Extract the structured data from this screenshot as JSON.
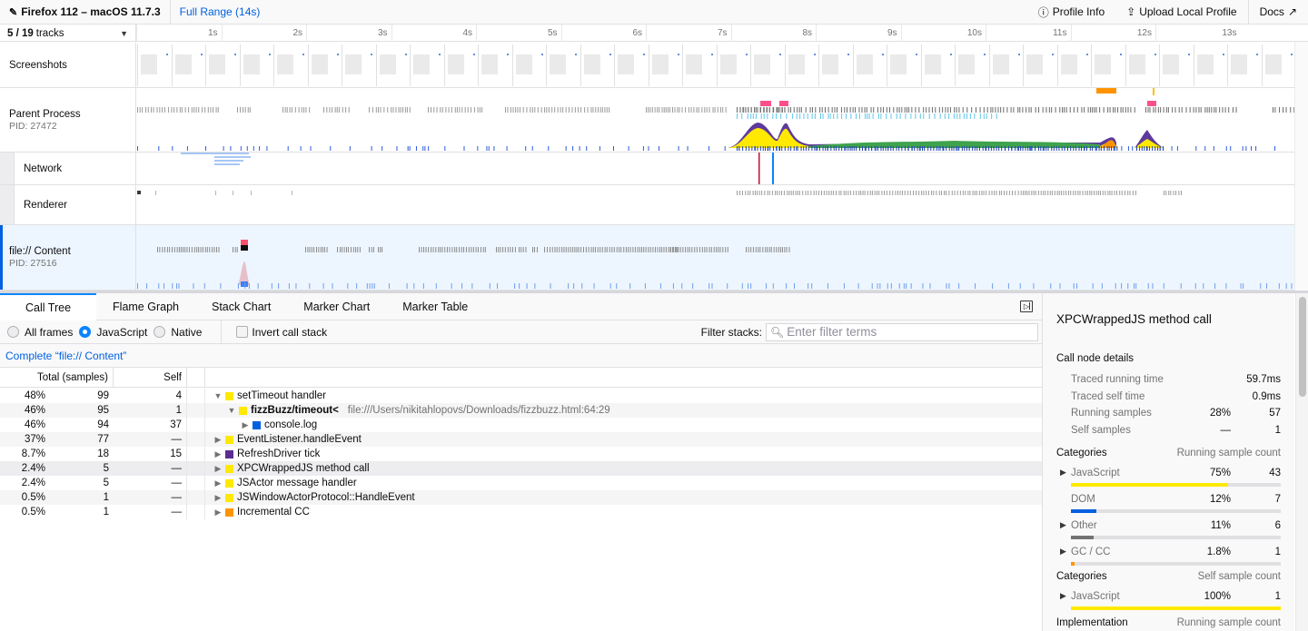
{
  "topbar": {
    "title": "Firefox 112 – macOS 11.7.3",
    "range": "Full Range (14s)",
    "profile_info": "Profile Info",
    "upload": "Upload Local Profile",
    "docs": "Docs"
  },
  "timeline": {
    "tracks_visible": "5 / 19",
    "tracks_label": "tracks",
    "ticks": [
      "1s",
      "2s",
      "3s",
      "4s",
      "5s",
      "6s",
      "7s",
      "8s",
      "9s",
      "10s",
      "11s",
      "12s",
      "13s"
    ],
    "tracks": [
      {
        "name": "Screenshots"
      },
      {
        "name": "Parent Process",
        "pid": "PID: 27472"
      },
      {
        "name": "Network"
      },
      {
        "name": "Renderer"
      },
      {
        "name": "file:// Content",
        "pid": "PID: 27516"
      }
    ]
  },
  "tabs": [
    "Call Tree",
    "Flame Graph",
    "Stack Chart",
    "Marker Chart",
    "Marker Table"
  ],
  "active_tab": "Call Tree",
  "settings": {
    "radios": [
      {
        "label": "All frames",
        "checked": false
      },
      {
        "label": "JavaScript",
        "checked": true
      },
      {
        "label": "Native",
        "checked": false
      }
    ],
    "invert_label": "Invert call stack",
    "invert_checked": false,
    "filter_label": "Filter stacks:",
    "filter_placeholder": "Enter filter terms",
    "filter_value": ""
  },
  "breadcrumb": "Complete “file:// Content”",
  "tree": {
    "headers": {
      "total": "Total (samples)",
      "self": "Self"
    },
    "rows": [
      {
        "pct": "48%",
        "total": "99",
        "self": "4",
        "depth": 0,
        "twisty": "open",
        "color": "#ffe900",
        "name": "setTimeout handler",
        "origin": "",
        "bold": false
      },
      {
        "pct": "46%",
        "total": "95",
        "self": "1",
        "depth": 1,
        "twisty": "open",
        "color": "#ffe900",
        "name": "fizzBuzz/timeout<",
        "origin": "file:///Users/nikitahlopovs/Downloads/fizzbuzz.html:64:29",
        "bold": true
      },
      {
        "pct": "46%",
        "total": "94",
        "self": "37",
        "depth": 2,
        "twisty": "closed",
        "color": "#0060df",
        "name": "console.log",
        "origin": "",
        "bold": false
      },
      {
        "pct": "37%",
        "total": "77",
        "self": "—",
        "depth": 0,
        "twisty": "closed",
        "color": "#ffe900",
        "name": "EventListener.handleEvent",
        "origin": "",
        "bold": false
      },
      {
        "pct": "8.7%",
        "total": "18",
        "self": "15",
        "depth": 0,
        "twisty": "closed",
        "color": "#5c2c91",
        "name": "RefreshDriver tick",
        "origin": "",
        "bold": false
      },
      {
        "pct": "2.4%",
        "total": "5",
        "self": "—",
        "depth": 0,
        "twisty": "closed",
        "color": "#ffe900",
        "name": "XPCWrappedJS method call",
        "origin": "",
        "bold": false
      },
      {
        "pct": "2.4%",
        "total": "5",
        "self": "—",
        "depth": 0,
        "twisty": "closed",
        "color": "#ffe900",
        "name": "JSActor message handler",
        "origin": "",
        "bold": false
      },
      {
        "pct": "0.5%",
        "total": "1",
        "self": "—",
        "depth": 0,
        "twisty": "closed",
        "color": "#ffe900",
        "name": "JSWindowActorProtocol::HandleEvent",
        "origin": "",
        "bold": false
      },
      {
        "pct": "0.5%",
        "total": "1",
        "self": "—",
        "depth": 0,
        "twisty": "closed",
        "color": "#ff9400",
        "name": "Incremental CC",
        "origin": "",
        "bold": false
      }
    ]
  },
  "sidebar": {
    "title": "XPCWrappedJS method call",
    "details_heading": "Call node details",
    "details": [
      {
        "label": "Traced running time",
        "pct": "",
        "value": "59.7ms"
      },
      {
        "label": "Traced self time",
        "pct": "",
        "value": "0.9ms"
      },
      {
        "label": "Running samples",
        "pct": "28%",
        "value": "57"
      },
      {
        "label": "Self samples",
        "pct": "—",
        "value": "1"
      }
    ],
    "categories_running": {
      "heading": "Categories",
      "subheading": "Running sample count",
      "items": [
        {
          "name": "JavaScript",
          "pct": "75%",
          "count": "43",
          "fraction": 0.75,
          "color": "#ffe900",
          "expandable": true
        },
        {
          "name": "DOM",
          "pct": "12%",
          "count": "7",
          "fraction": 0.12,
          "color": "#0060df",
          "expandable": false
        },
        {
          "name": "Other",
          "pct": "11%",
          "count": "6",
          "fraction": 0.11,
          "color": "#737373",
          "expandable": true
        },
        {
          "name": "GC / CC",
          "pct": "1.8%",
          "count": "1",
          "fraction": 0.018,
          "color": "#ff9400",
          "expandable": true
        }
      ]
    },
    "categories_self": {
      "heading": "Categories",
      "subheading": "Self sample count",
      "items": [
        {
          "name": "JavaScript",
          "pct": "100%",
          "count": "1",
          "fraction": 1.0,
          "color": "#ffe900",
          "expandable": true
        }
      ]
    },
    "implementation": {
      "heading": "Implementation",
      "subheading": "Running sample count"
    }
  }
}
